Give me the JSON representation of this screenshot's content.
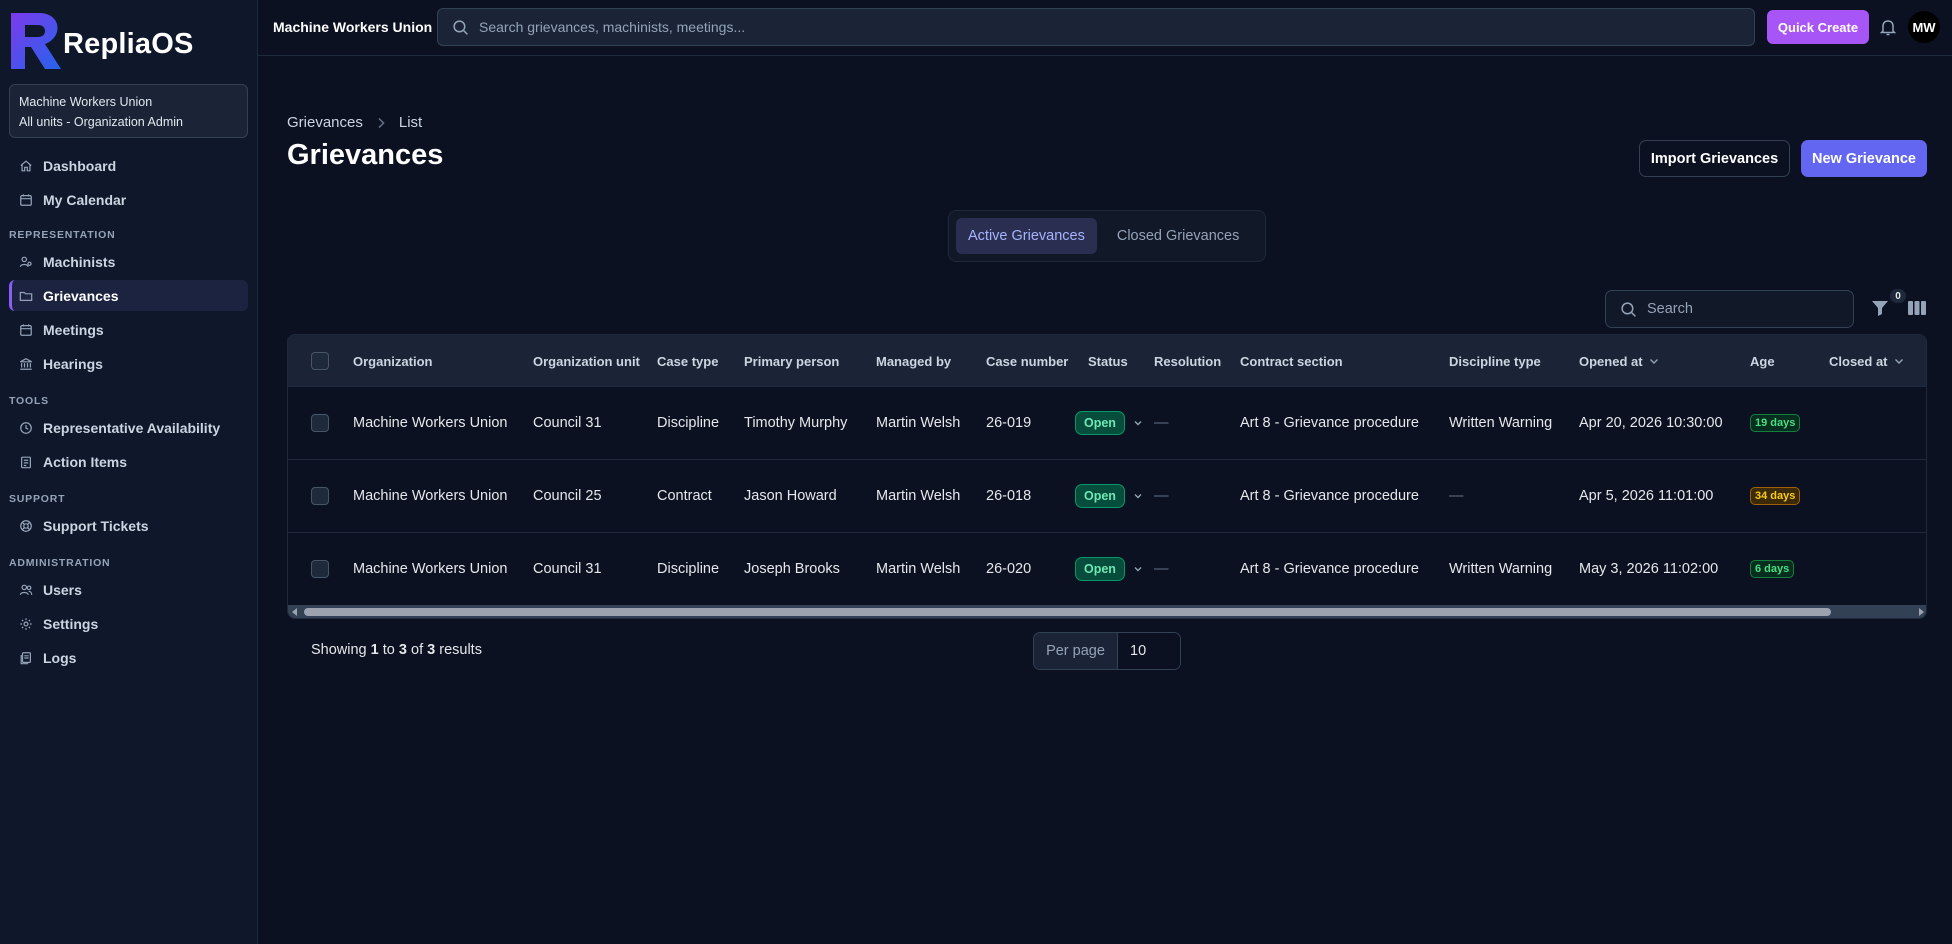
{
  "app": {
    "name": "RepliaOS"
  },
  "org_box": {
    "name": "Machine Workers Union",
    "scope": "All units - Organization Admin"
  },
  "sidebar": {
    "top_items": [
      {
        "label": "Dashboard",
        "icon": "home-icon"
      },
      {
        "label": "My Calendar",
        "icon": "calendar-icon"
      }
    ],
    "sections": [
      {
        "title": "REPRESENTATION",
        "items": [
          {
            "label": "Machinists",
            "icon": "users-gear-icon"
          },
          {
            "label": "Grievances",
            "icon": "folder-icon",
            "active": true
          },
          {
            "label": "Meetings",
            "icon": "calendar-icon"
          },
          {
            "label": "Hearings",
            "icon": "building-columns-icon"
          }
        ]
      },
      {
        "title": "TOOLS",
        "items": [
          {
            "label": "Representative Availability",
            "icon": "clock-icon"
          },
          {
            "label": "Action Items",
            "icon": "clipboard-list-icon"
          }
        ]
      },
      {
        "title": "SUPPORT",
        "items": [
          {
            "label": "Support Tickets",
            "icon": "lifebuoy-icon"
          }
        ]
      },
      {
        "title": "ADMINISTRATION",
        "items": [
          {
            "label": "Users",
            "icon": "users-icon"
          },
          {
            "label": "Settings",
            "icon": "gear-icon"
          },
          {
            "label": "Logs",
            "icon": "logs-icon"
          }
        ]
      }
    ]
  },
  "topbar": {
    "org_name": "Machine Workers Union",
    "search_placeholder": "Search grievances, machinists, meetings...",
    "quick_create_label": "Quick Create",
    "avatar_initials": "MW"
  },
  "page": {
    "breadcrumb": [
      "Grievances",
      "List"
    ],
    "title": "Grievances",
    "import_label": "Import Grievances",
    "new_label": "New Grievance",
    "tabs": [
      {
        "label": "Active Grievances",
        "active": true
      },
      {
        "label": "Closed Grievances",
        "active": false
      }
    ],
    "table_search_placeholder": "Search",
    "filter_count": "0"
  },
  "table": {
    "columns": [
      "Organization",
      "Organization unit",
      "Case type",
      "Primary person",
      "Managed by",
      "Case number",
      "Status",
      "Resolution",
      "Contract section",
      "Discipline type",
      "Opened at",
      "Age",
      "Closed at"
    ],
    "rows": [
      {
        "organization": "Machine Workers Union",
        "unit": "Council 31",
        "case_type": "Discipline",
        "primary_person": "Timothy Murphy",
        "managed_by": "Martin Welsh",
        "case_number": "26-019",
        "status": "Open",
        "resolution": "—",
        "contract_section": "Art 8 - Grievance procedure",
        "discipline_type": "Written Warning",
        "opened_at": "Apr 20, 2026 10:30:00",
        "age": "19 days",
        "age_color": "#4ade80",
        "closed_at": ""
      },
      {
        "organization": "Machine Workers Union",
        "unit": "Council 25",
        "case_type": "Contract",
        "primary_person": "Jason Howard",
        "managed_by": "Martin Welsh",
        "case_number": "26-018",
        "status": "Open",
        "resolution": "—",
        "contract_section": "Art 8 - Grievance procedure",
        "discipline_type": "—",
        "opened_at": "Apr 5, 2026 11:01:00",
        "age": "34 days",
        "age_color": "#facc15",
        "closed_at": ""
      },
      {
        "organization": "Machine Workers Union",
        "unit": "Council 31",
        "case_type": "Discipline",
        "primary_person": "Joseph Brooks",
        "managed_by": "Martin Welsh",
        "case_number": "26-020",
        "status": "Open",
        "resolution": "—",
        "contract_section": "Art 8 - Grievance procedure",
        "discipline_type": "Written Warning",
        "opened_at": "May 3, 2026 11:02:00",
        "age": "6 days",
        "age_color": "#4ade80",
        "closed_at": ""
      }
    ]
  },
  "pagination": {
    "showing_prefix": "Showing",
    "from": "1",
    "to_word": "to",
    "to": "3",
    "of_word": "of",
    "total": "3",
    "results_word": "results",
    "per_page_label": "Per page",
    "per_page_value": "10"
  },
  "colors": {
    "accent": "#6366f1",
    "quick_create": "#a855f7",
    "active_nav_border": "#8b5cf6",
    "status_open": "#6ee7b7"
  }
}
